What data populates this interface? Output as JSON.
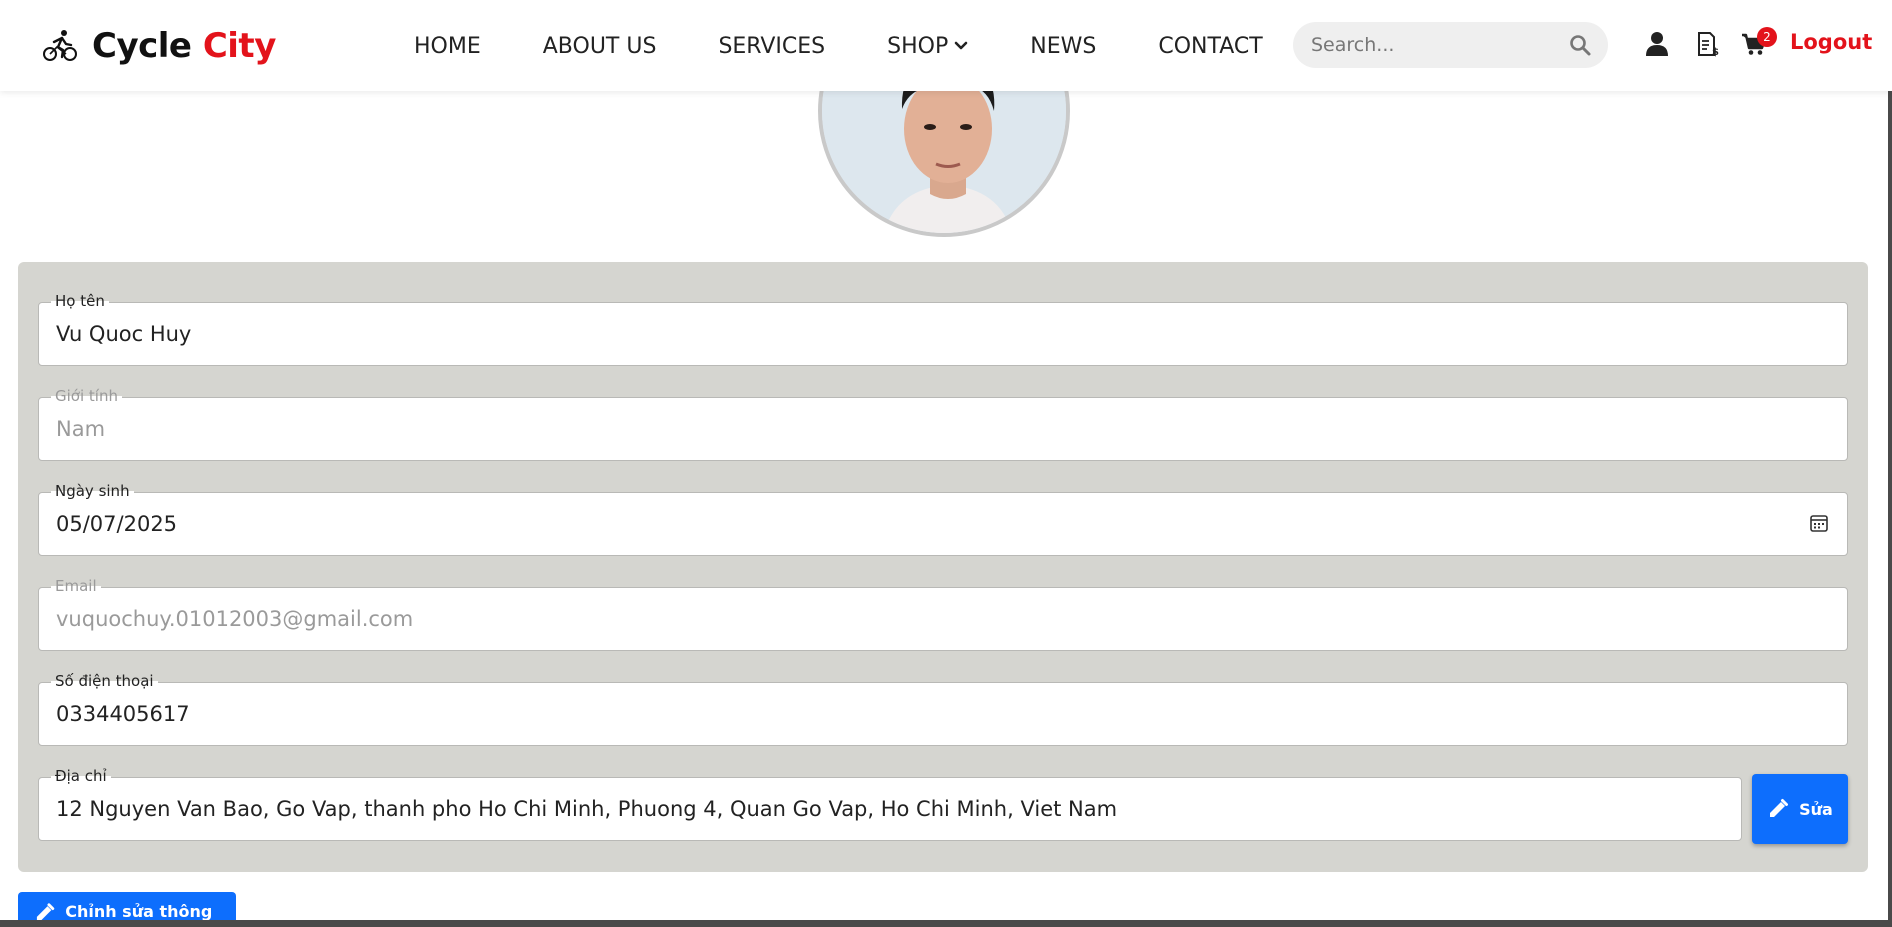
{
  "header": {
    "logo_word1": "Cycle",
    "logo_word2": "City",
    "logo_icon": "cyclist-icon",
    "nav": [
      {
        "label": "HOME"
      },
      {
        "label": "ABOUT US"
      },
      {
        "label": "SERVICES"
      },
      {
        "label": "SHOP"
      },
      {
        "label": "NEWS"
      },
      {
        "label": "CONTACT"
      }
    ],
    "search_placeholder": "Search...",
    "cart_count": "2",
    "logout_label": "Logout",
    "icons": [
      "user-icon",
      "invoice-icon",
      "cart-icon",
      "search-icon"
    ]
  },
  "colors": {
    "brand_red": "#e3131b",
    "button_blue": "#0d6efd",
    "panel_bg": "#d5d5d0"
  },
  "profile": {
    "fields": [
      {
        "label": "Họ tên",
        "value": "Vu Quoc Huy",
        "disabled": false
      },
      {
        "label": "Giới tính",
        "value": "Nam",
        "disabled": true
      },
      {
        "label": "Ngày sinh",
        "value": "05/07/2025",
        "disabled": false
      },
      {
        "label": "Email",
        "value": "vuquochuy.01012003@gmail.com",
        "disabled": true
      },
      {
        "label": "Số điện thoại",
        "value": "0334405617",
        "disabled": false
      },
      {
        "label": "Địa chỉ",
        "value": "12 Nguyen Van Bao, Go Vap, thanh pho Ho Chi Minh, Phuong 4, Quan Go Vap, Ho Chi Minh, Viet Nam",
        "disabled": false
      }
    ],
    "address_edit_label": "Sửa",
    "edit_info_label": "Chỉnh sửa thông tin"
  }
}
